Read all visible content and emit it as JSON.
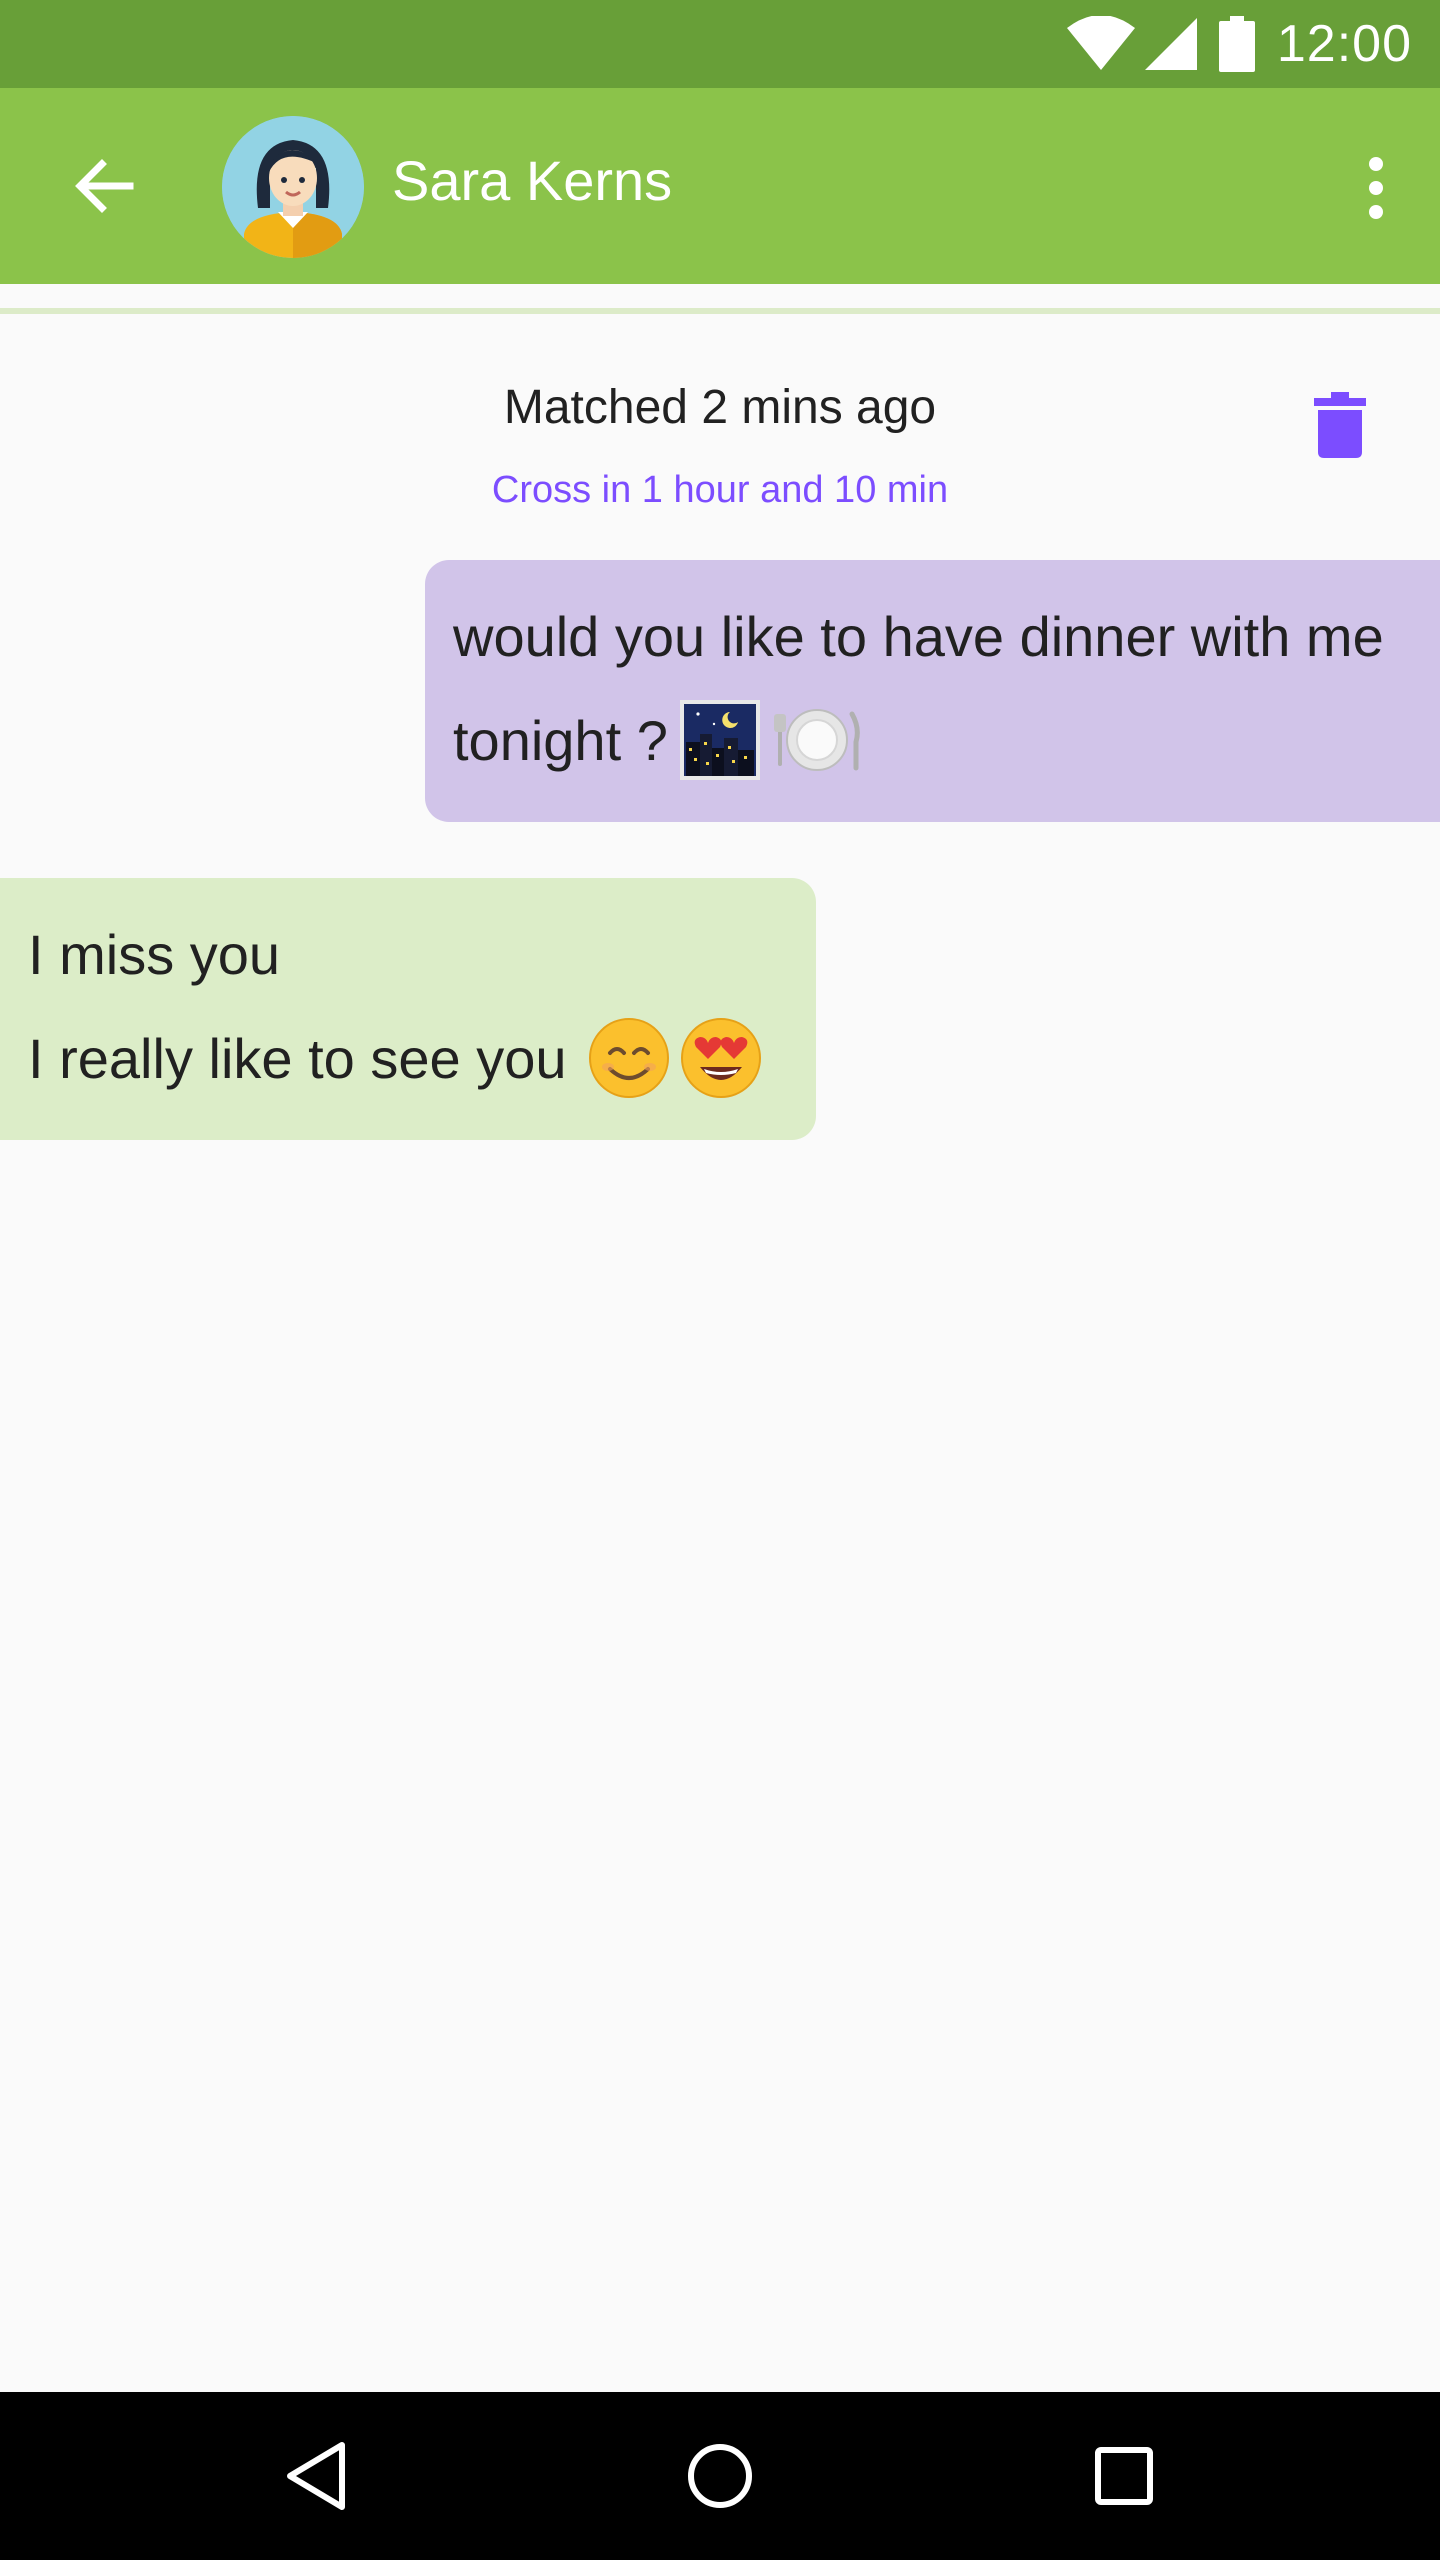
{
  "status_bar": {
    "time": "12:00",
    "icons": [
      "wifi-icon",
      "cell-signal-icon",
      "battery-icon"
    ]
  },
  "app_bar": {
    "contact_name": "Sara Kerns",
    "back_icon": "arrow-back-icon",
    "menu_icon": "more-vert-icon",
    "colors": {
      "app_bar": "#8bc34a",
      "status_bar": "#689f38"
    }
  },
  "match_info": {
    "title": "Matched 2 mins ago",
    "subtitle": "Cross in 1 hour and 10 min",
    "delete_icon": "trash-icon",
    "accent": "#7c4dff"
  },
  "messages": [
    {
      "direction": "outgoing",
      "lines": [
        "would you like to have dinner with me",
        "tonight ?"
      ],
      "emojis": [
        "night-city-emoji",
        "fork-knife-plate-emoji"
      ],
      "color": "#d1c4e9"
    },
    {
      "direction": "incoming",
      "lines": [
        "I miss you",
        "I really like to see you"
      ],
      "emojis": [
        "smiling-face-emoji",
        "heart-eyes-emoji"
      ],
      "color": "#dcedc8"
    }
  ],
  "nav_bar": {
    "buttons": [
      "back-triangle-icon",
      "home-circle-icon",
      "recents-square-icon"
    ]
  }
}
